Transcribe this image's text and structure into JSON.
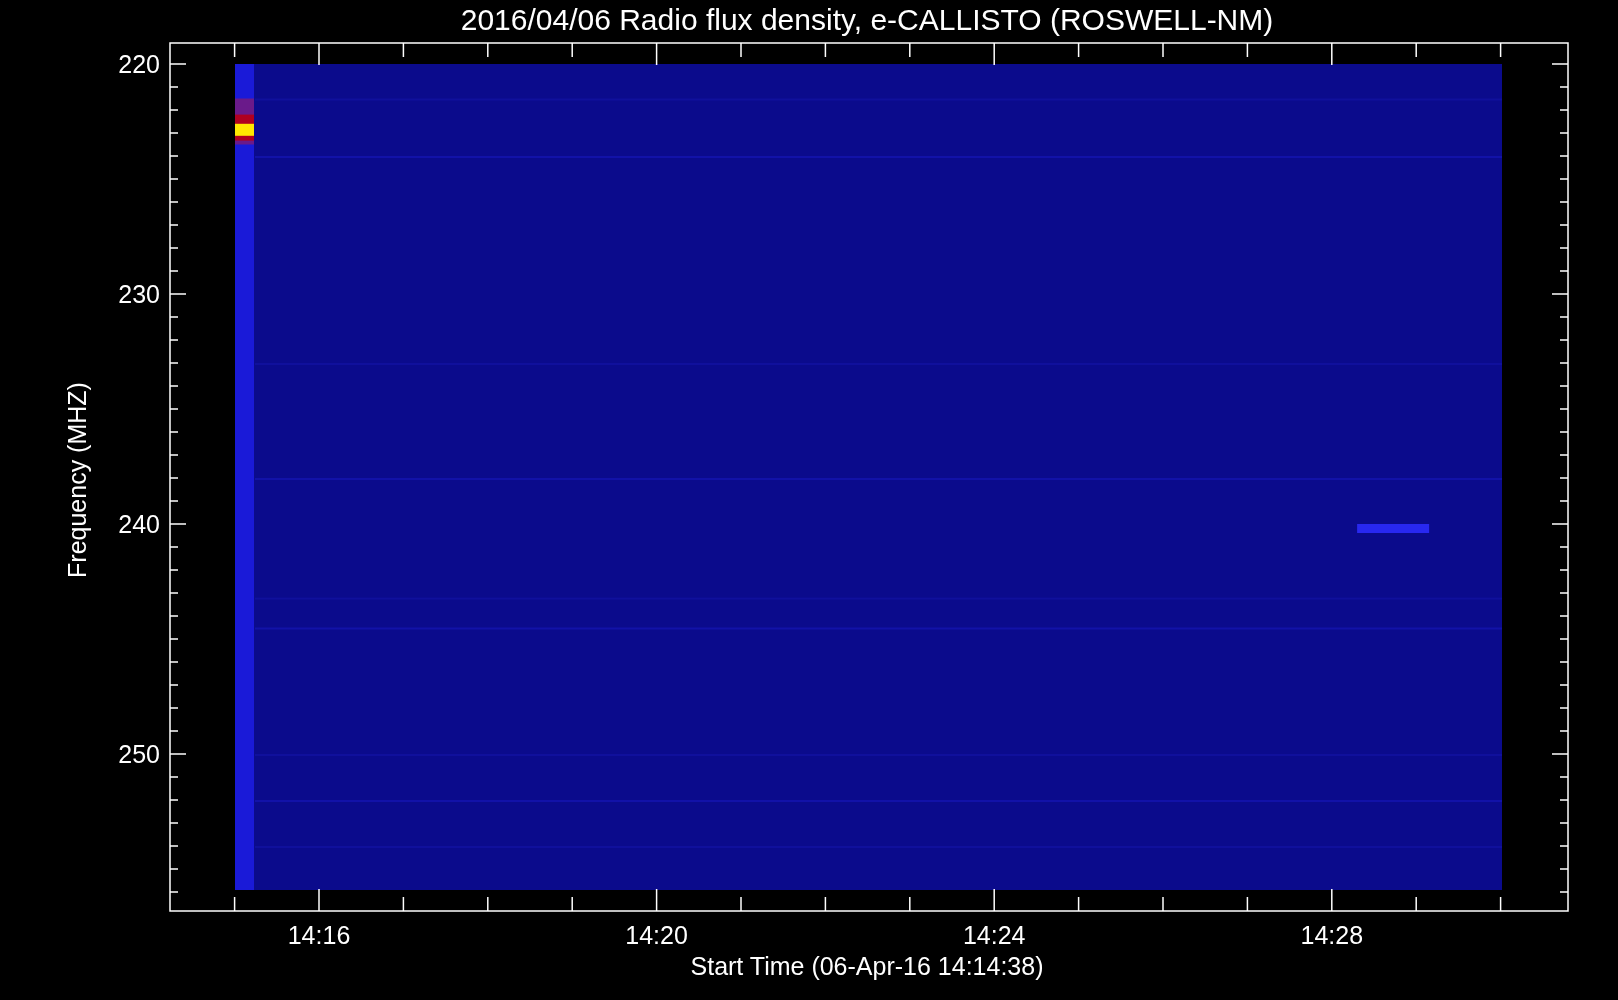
{
  "title": "2016/04/06  Radio flux density, e-CALLISTO (ROSWELL-NM)",
  "ylabel": "Frequency (MHZ)",
  "xlabel": "Start Time (06-Apr-16 14:14:38)",
  "yticks": [
    "220",
    "230",
    "240",
    "250"
  ],
  "xticks": [
    "14:16",
    "14:20",
    "14:24",
    "14:28"
  ]
}
